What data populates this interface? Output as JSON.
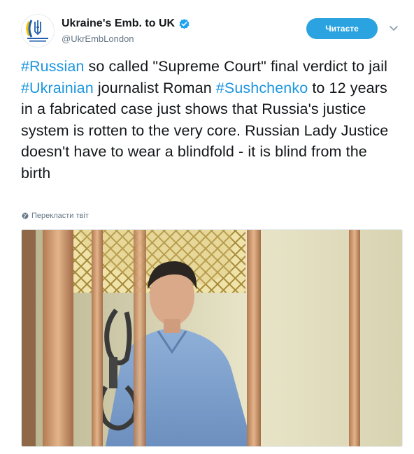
{
  "author": {
    "display_name": "Ukraine's Emb. to UK",
    "handle": "@UkrEmbLondon",
    "verified": true,
    "avatar_caption": "Embassy of Ukraine London"
  },
  "follow_button": {
    "label": "Читаєте"
  },
  "tweet": {
    "segments": [
      {
        "text": "#Russian",
        "type": "hashtag"
      },
      {
        "text": " so called \"Supreme Court\" final verdict to jail ",
        "type": "text"
      },
      {
        "text": "#Ukrainian",
        "type": "hashtag"
      },
      {
        "text": " journalist Roman ",
        "type": "text"
      },
      {
        "text": "#Sushchenko",
        "type": "hashtag"
      },
      {
        "text": " to 12 years in a fabricated case just shows that Russia's justice system is rotten to the very core. Russian Lady Justice doesn't have to wear a blindfold - it is blind from the birth",
        "type": "text"
      }
    ]
  },
  "translate_link": {
    "label": "Перекласти твіт",
    "icon": "globe-icon"
  },
  "colors": {
    "accent": "#1b95e0",
    "follow_bg": "#2aa3e0",
    "muted": "#657786"
  }
}
